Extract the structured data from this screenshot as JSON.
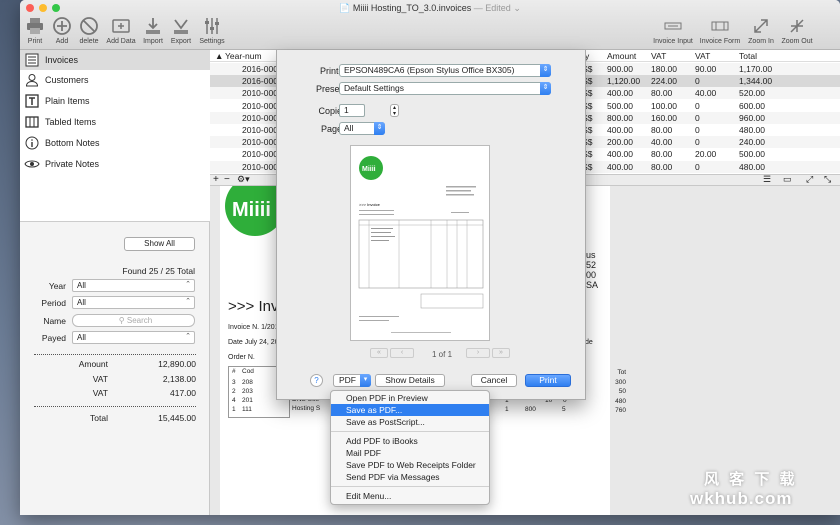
{
  "window": {
    "title": "Miiii Hosting_TO_3.0.invoices",
    "title_suffix": "— Edited",
    "traffic_lights": [
      "#fc5f57",
      "#fdbc2e",
      "#33c748"
    ]
  },
  "toolbar": {
    "left": [
      {
        "label": "Print",
        "icon": "printer-icon"
      },
      {
        "label": "Add",
        "icon": "plus-circle-icon"
      },
      {
        "label": "delete",
        "icon": "prohibit-icon"
      },
      {
        "label": "Add Data",
        "icon": "add-data-icon"
      },
      {
        "label": "Import",
        "icon": "import-icon"
      },
      {
        "label": "Export",
        "icon": "export-icon"
      },
      {
        "label": "Settings",
        "icon": "sliders-icon"
      }
    ],
    "right": [
      {
        "label": "Invoice Input",
        "icon": "invoice-input-icon"
      },
      {
        "label": "Invoice Form",
        "icon": "invoice-form-icon"
      },
      {
        "label": "Zoom In",
        "icon": "zoom-in-icon"
      },
      {
        "label": "Zoom Out",
        "icon": "zoom-out-icon"
      }
    ]
  },
  "sidebar": {
    "items": [
      {
        "label": "Invoices",
        "icon": "invoice-list-icon",
        "selected": true
      },
      {
        "label": "Customers",
        "icon": "person-icon"
      },
      {
        "label": "Plain Items",
        "icon": "text-icon"
      },
      {
        "label": "Tabled Items",
        "icon": "table-icon"
      },
      {
        "label": "Bottom Notes",
        "icon": "info-icon"
      },
      {
        "label": "Private Notes",
        "icon": "eye-icon"
      }
    ],
    "show_all": "Show All",
    "found": "Found 25 / 25 Total",
    "filters": {
      "year": {
        "label": "Year",
        "value": "All"
      },
      "period": {
        "label": "Period",
        "value": "All"
      },
      "name": {
        "label": "Name",
        "placeholder": "Search"
      },
      "payed": {
        "label": "Payed",
        "value": "All"
      }
    },
    "summary": {
      "amount": {
        "label": "Amount",
        "value": "12,890.00"
      },
      "vat1": {
        "label": "VAT",
        "value": "2,138.00"
      },
      "vat2": {
        "label": "VAT",
        "value": "417.00"
      },
      "total": {
        "label": "Total",
        "value": "15,445.00"
      }
    }
  },
  "grid": {
    "headers": {
      "sort_arrow": "▲",
      "year_num": "Year-num",
      "currency": "ncy",
      "amount": "Amount",
      "vat1": "VAT",
      "vat2": "VAT",
      "total": "Total"
    },
    "rows": [
      {
        "year_num": "2016-00003",
        "currency": "US$",
        "amount": "900.00",
        "vat1": "180.00",
        "vat2": "90.00",
        "total": "1,170.00"
      },
      {
        "year_num": "2016-00001",
        "currency": "US$",
        "amount": "1,120.00",
        "vat1": "224.00",
        "vat2": "0",
        "total": "1,344.00"
      },
      {
        "year_num": "2010-00013",
        "currency": "US$",
        "amount": "400.00",
        "vat1": "80.00",
        "vat2": "40.00",
        "total": "520.00"
      },
      {
        "year_num": "2010-00012",
        "currency": "US$",
        "amount": "500.00",
        "vat1": "100.00",
        "vat2": "0",
        "total": "600.00"
      },
      {
        "year_num": "2010-00011",
        "currency": "US$",
        "amount": "800.00",
        "vat1": "160.00",
        "vat2": "0",
        "total": "960.00"
      },
      {
        "year_num": "2010-00010",
        "currency": "US$",
        "amount": "400.00",
        "vat1": "80.00",
        "vat2": "0",
        "total": "480.00"
      },
      {
        "year_num": "2010-00009",
        "currency": "US$",
        "amount": "200.00",
        "vat1": "40.00",
        "vat2": "0",
        "total": "240.00"
      },
      {
        "year_num": "2010-00008",
        "currency": "US$",
        "amount": "400.00",
        "vat1": "80.00",
        "vat2": "20.00",
        "total": "500.00"
      },
      {
        "year_num": "2010-00007",
        "currency": "US$",
        "amount": "400.00",
        "vat1": "80.00",
        "vat2": "0",
        "total": "480.00"
      }
    ]
  },
  "document": {
    "logo_text": "Miiii",
    "heading": ">>> Invo",
    "invoice_no": "Invoice N. 1/2016",
    "date": "Date July 24, 2016",
    "order_no": "Order N.",
    "cols": {
      "num": "#",
      "cod": "Cod"
    },
    "lines": [
      {
        "n": "3",
        "cod": "208"
      },
      {
        "n": "2",
        "cod": "203"
      },
      {
        "n": "4",
        "cod": "201",
        "desc": "DNS Use"
      },
      {
        "n": "1",
        "cod": "111",
        "desc": "Hosting S"
      }
    ],
    "right_fragments": [
      "us",
      "52",
      "00",
      "SA"
    ],
    "right_col": {
      "hdr": "Tot",
      "vals": [
        "300",
        "50",
        "480",
        "760"
      ],
      "label": "de"
    },
    "mid_vals": {
      "a": "1",
      "b": "10",
      "c": "0",
      "d": "1",
      "e": "800",
      "f": "5"
    }
  },
  "print_dialog": {
    "printer": {
      "label": "Printer:",
      "value": "EPSON489CA6 (Epson Stylus Office BX305)"
    },
    "presets": {
      "label": "Presets:",
      "value": "Default Settings"
    },
    "copies": {
      "label": "Copies:",
      "value": "1"
    },
    "pages": {
      "label": "Pages:",
      "value": "All"
    },
    "page_indicator": "1 of 1",
    "help": "?",
    "pdf": "PDF",
    "show_details": "Show Details",
    "cancel": "Cancel",
    "print": "Print",
    "preview_heading": ">>> Invoice"
  },
  "pdf_menu": {
    "items": [
      {
        "label": "Open PDF in Preview"
      },
      {
        "label": "Save as PDF...",
        "highlighted": true
      },
      {
        "label": "Save as PostScript..."
      },
      {
        "label": "Add PDF to iBooks"
      },
      {
        "label": "Mail PDF"
      },
      {
        "label": "Save PDF to Web Receipts Folder"
      },
      {
        "label": "Send PDF via Messages"
      },
      {
        "label": "Edit Menu..."
      }
    ]
  },
  "watermark": {
    "line1": "风 客 下 载",
    "line2": "wkhub.com"
  }
}
